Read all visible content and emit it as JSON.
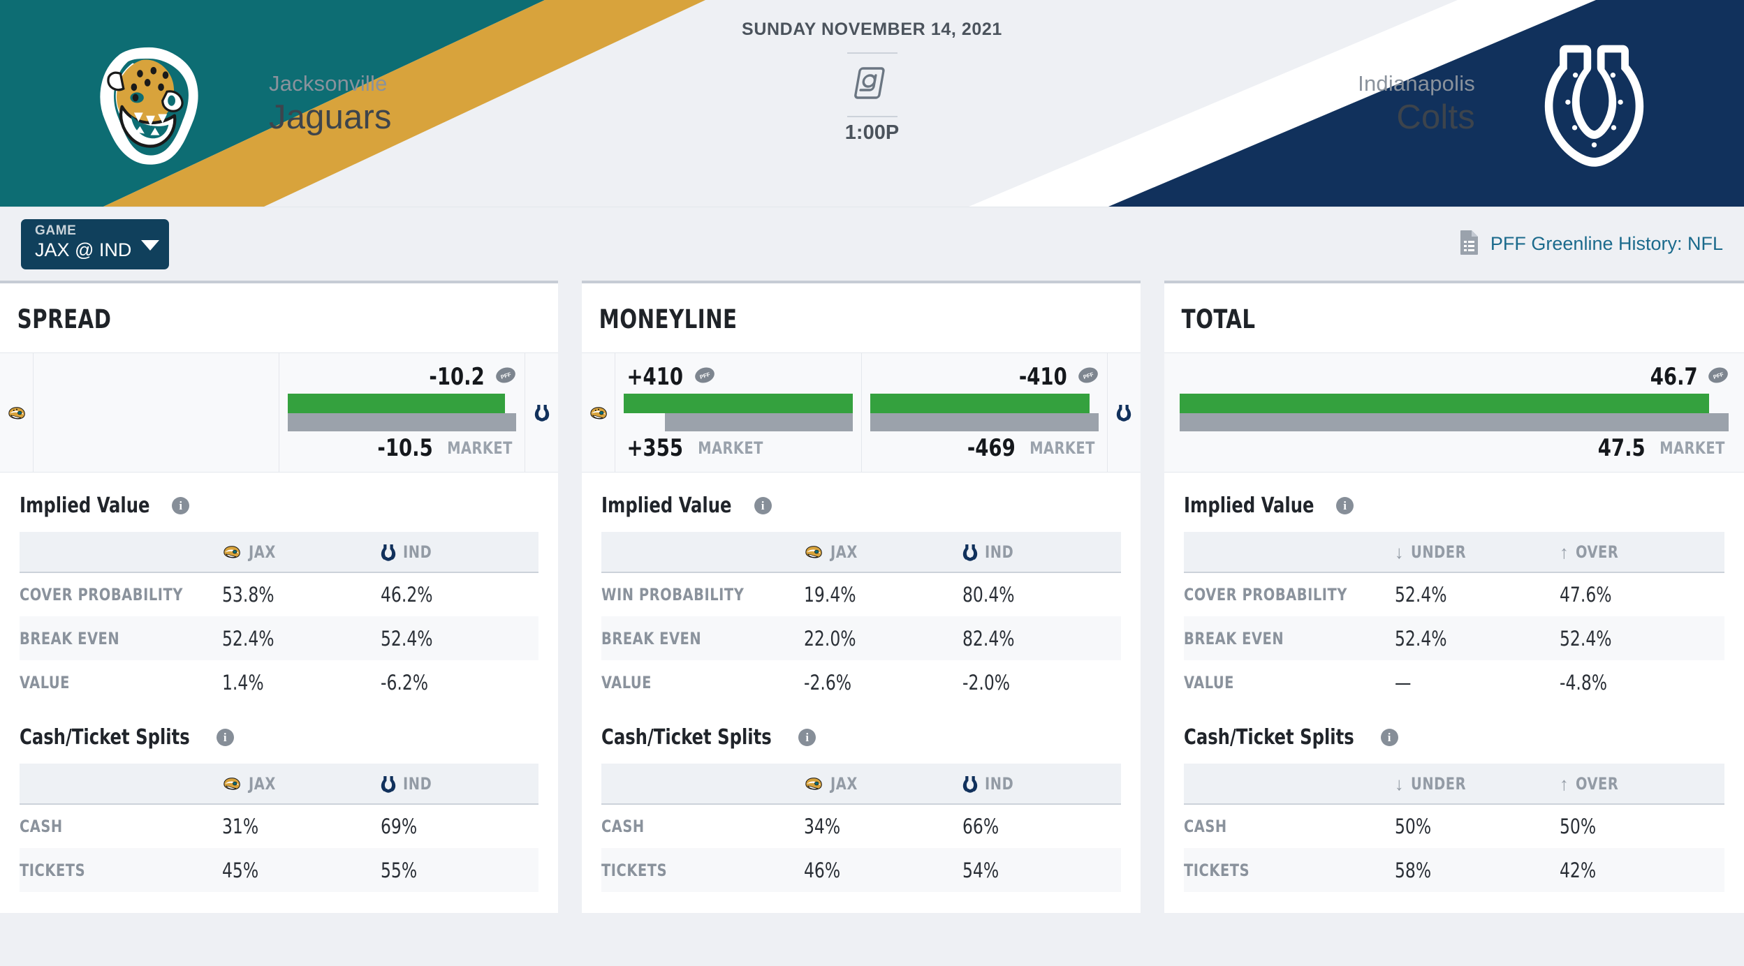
{
  "header": {
    "away": {
      "city": "Jacksonville",
      "name": "Jaguars",
      "abbr": "JAX",
      "logo": "jaguars-logo",
      "primary": "#0d6d73",
      "secondary": "#d8a33c"
    },
    "home": {
      "city": "Indianapolis",
      "name": "Colts",
      "abbr": "IND",
      "logo": "colts-logo",
      "primary": "#11315c",
      "secondary": "#ffffff"
    },
    "date": "SUNDAY NOVEMBER 14, 2021",
    "at_symbol": "@",
    "time": "1:00P"
  },
  "toolbar": {
    "game_select": {
      "label": "GAME",
      "value": "JAX @ IND",
      "caret": "chevron-down-icon"
    },
    "pff_link": {
      "text": "PFF Greenline History: NFL",
      "icon": "document-icon",
      "color": "#1b6a8c"
    }
  },
  "cards": [
    {
      "title": "SPREAD",
      "line": {
        "style": "single",
        "left": {
          "pff": "",
          "market": "",
          "market_label": "",
          "bar_green_pct": 0,
          "bar_gray_pct": 0
        },
        "right": {
          "pff": "-10.2",
          "market": "-10.5",
          "market_label": "MARKET",
          "bar_green_pct": 95,
          "bar_gray_pct": 100
        }
      },
      "implied_value": {
        "title": "Implied Value",
        "columns": [
          {
            "label": "JAX",
            "icon": "jaguars-logo"
          },
          {
            "label": "IND",
            "icon": "colts-logo"
          }
        ],
        "rows": [
          {
            "label": "COVER PROBABILITY",
            "a": "53.8%",
            "b": "46.2%"
          },
          {
            "label": "BREAK EVEN",
            "a": "52.4%",
            "b": "52.4%"
          },
          {
            "label": "VALUE",
            "a": "1.4%",
            "b": "-6.2%"
          }
        ]
      },
      "splits": {
        "title": "Cash/Ticket Splits",
        "columns": [
          {
            "label": "JAX",
            "icon": "jaguars-logo"
          },
          {
            "label": "IND",
            "icon": "colts-logo"
          }
        ],
        "rows": [
          {
            "label": "CASH",
            "a": "31%",
            "b": "69%"
          },
          {
            "label": "TICKETS",
            "a": "45%",
            "b": "55%"
          }
        ]
      }
    },
    {
      "title": "MONEYLINE",
      "line": {
        "style": "double",
        "left": {
          "pff": "+410",
          "market": "+355",
          "market_label": "MARKET",
          "bar_green_pct": 100,
          "bar_gray_pct": 82
        },
        "right": {
          "pff": "-410",
          "market": "-469",
          "market_label": "MARKET",
          "bar_green_pct": 96,
          "bar_gray_pct": 100
        }
      },
      "implied_value": {
        "title": "Implied Value",
        "columns": [
          {
            "label": "JAX",
            "icon": "jaguars-logo"
          },
          {
            "label": "IND",
            "icon": "colts-logo"
          }
        ],
        "rows": [
          {
            "label": "WIN PROBABILITY",
            "a": "19.4%",
            "b": "80.4%"
          },
          {
            "label": "BREAK EVEN",
            "a": "22.0%",
            "b": "82.4%"
          },
          {
            "label": "VALUE",
            "a": "-2.6%",
            "b": "-2.0%"
          }
        ]
      },
      "splits": {
        "title": "Cash/Ticket Splits",
        "columns": [
          {
            "label": "JAX",
            "icon": "jaguars-logo"
          },
          {
            "label": "IND",
            "icon": "colts-logo"
          }
        ],
        "rows": [
          {
            "label": "CASH",
            "a": "34%",
            "b": "66%"
          },
          {
            "label": "TICKETS",
            "a": "46%",
            "b": "54%"
          }
        ]
      }
    },
    {
      "title": "TOTAL",
      "line": {
        "style": "full",
        "left": {
          "pff": "",
          "market": "",
          "market_label": "",
          "bar_green_pct": 0,
          "bar_gray_pct": 0
        },
        "right": {
          "pff": "46.7",
          "market": "47.5",
          "market_label": "MARKET",
          "bar_green_pct": 95,
          "bar_gray_pct": 100
        }
      },
      "implied_value": {
        "title": "Implied Value",
        "columns": [
          {
            "label": "UNDER",
            "icon": "arrow-down-icon"
          },
          {
            "label": "OVER",
            "icon": "arrow-up-icon"
          }
        ],
        "rows": [
          {
            "label": "COVER PROBABILITY",
            "a": "52.4%",
            "b": "47.6%"
          },
          {
            "label": "BREAK EVEN",
            "a": "52.4%",
            "b": "52.4%"
          },
          {
            "label": "VALUE",
            "a": "—",
            "b": "-4.8%"
          }
        ]
      },
      "splits": {
        "title": "Cash/Ticket Splits",
        "columns": [
          {
            "label": "UNDER",
            "icon": "arrow-down-icon"
          },
          {
            "label": "OVER",
            "icon": "arrow-up-icon"
          }
        ],
        "rows": [
          {
            "label": "CASH",
            "a": "50%",
            "b": "50%"
          },
          {
            "label": "TICKETS",
            "a": "58%",
            "b": "42%"
          }
        ]
      }
    }
  ],
  "colors": {
    "pff_green": "#34a13e",
    "market_gray": "#9ba2ab",
    "link_blue": "#1b6a8c",
    "select_navy": "#10405c"
  },
  "info_icon_char": "i"
}
